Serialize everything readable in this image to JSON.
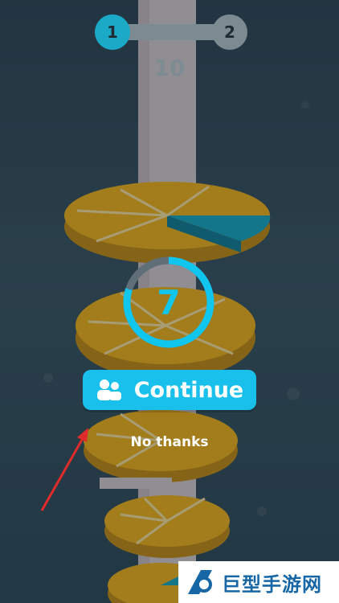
{
  "level": {
    "current": "1",
    "next": "2"
  },
  "score": "10",
  "revive": {
    "countdown": "7",
    "countdown_progress": 0.8,
    "continue_label": "Continue",
    "continue_icon": "group-people-icon",
    "no_thanks_label": "No thanks"
  },
  "watermark": {
    "text": "巨型手游网"
  },
  "colors": {
    "accent": "#19c0ec",
    "orange": "#f5b41d",
    "pole": "#d8cdd3",
    "danger_segment": "#1aa9c7",
    "arrow": "#e02b2b"
  }
}
